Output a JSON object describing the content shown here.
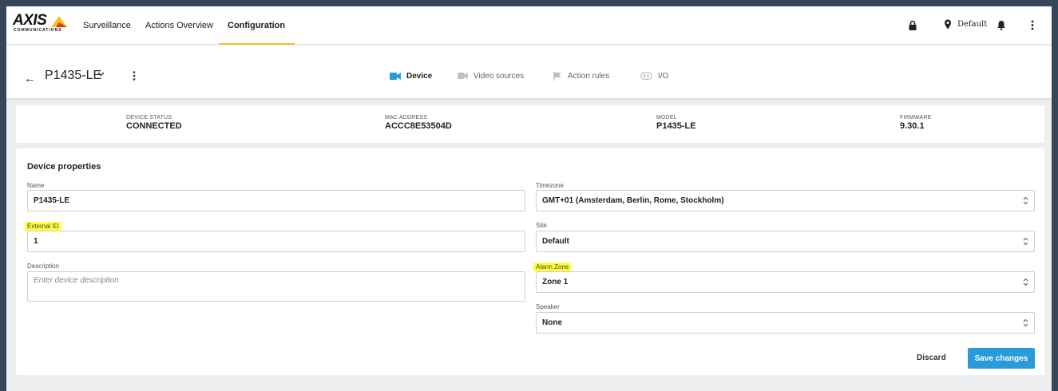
{
  "brand": {
    "logo_text": "AXIS",
    "logo_sub": "COMMUNICATIONS",
    "accent": "#f7c21c",
    "primary_button": "#2a9bd8"
  },
  "nav": {
    "items": [
      {
        "label": "Surveillance"
      },
      {
        "label": "Actions Overview"
      },
      {
        "label": "Configuration"
      }
    ],
    "active": "Configuration",
    "site_label": "Default",
    "icons": [
      "lock-icon",
      "location-pin-icon",
      "bell-icon",
      "more-vertical-icon"
    ]
  },
  "device_header": {
    "name": "P1435-LE",
    "tabs": [
      {
        "label": "Device",
        "icon": "video-camera-icon"
      },
      {
        "label": "Video sources",
        "icon": "video-camera-icon"
      },
      {
        "label": "Action rules",
        "icon": "flag-icon"
      },
      {
        "label": "I/O",
        "icon": "io-port-icon"
      }
    ],
    "active_tab": "Device"
  },
  "status": {
    "device_status": {
      "label": "DEVICE STATUS",
      "value": "CONNECTED"
    },
    "mac_address": {
      "label": "MAC ADDRESS",
      "value": "ACCC8E53504D"
    },
    "model": {
      "label": "MODEL",
      "value": "P1435-LE"
    },
    "firmware": {
      "label": "FIRMWARE",
      "value": "9.30.1"
    }
  },
  "properties": {
    "title": "Device properties",
    "name": {
      "label": "Name",
      "value": "P1435-LE"
    },
    "external_id": {
      "label": "External ID",
      "value": "1"
    },
    "description": {
      "label": "Description",
      "placeholder": "Enter device description"
    },
    "timezone": {
      "label": "Timezone",
      "value": "GMT+01 (Amsterdam, Berlin, Rome, Stockholm)"
    },
    "site": {
      "label": "Site",
      "value": "Default"
    },
    "alarm_zone": {
      "label": "Alarm Zone",
      "value": "Zone 1"
    },
    "speaker": {
      "label": "Speaker",
      "value": "None"
    },
    "discard_label": "Discard",
    "save_label": "Save changes"
  }
}
